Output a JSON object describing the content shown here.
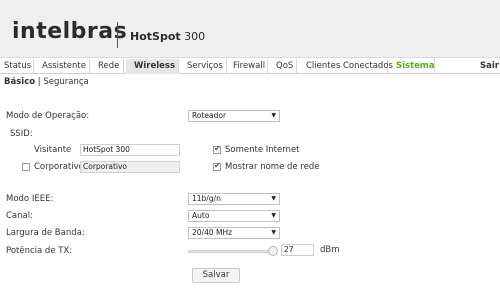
{
  "header": {
    "logo": "intelbras",
    "product_bold": "HotSpot",
    "product_rest": " 300"
  },
  "tabs": [
    {
      "label": "Status"
    },
    {
      "label": "Assistente"
    },
    {
      "label": "Rede"
    },
    {
      "label": "Wireless"
    },
    {
      "label": "Serviços"
    },
    {
      "label": "Firewall"
    },
    {
      "label": "QoS"
    },
    {
      "label": "Clientes Conectados"
    },
    {
      "label": "Sistema"
    },
    {
      "label": "Sair"
    }
  ],
  "active_tab": "Wireless",
  "subtabs": {
    "basic": "Básico",
    "separator": " | ",
    "security": "Segurança"
  },
  "form": {
    "mode_label": "Modo de Operação:",
    "mode_value": "Roteador",
    "ssid_label": "SSID:",
    "visitor_label": "Visitante",
    "visitor_value": "HotSpot 300",
    "internet_only_label": "Somente Internet",
    "internet_only_checked": true,
    "corporate_label": "Corporativo",
    "corporate_checked": false,
    "corporate_value": "Corporativo",
    "show_network_label": "Mostrar nome de rede",
    "show_network_checked": true,
    "ieee_label": "Modo IEEE:",
    "ieee_value": "11b/g/n",
    "channel_label": "Canal:",
    "channel_value": "Auto",
    "bandwidth_label": "Largura de Banda:",
    "bandwidth_value": "20/40 MHz",
    "tx_label": "Potência de TX:",
    "tx_value": "27",
    "tx_unit": "dBm",
    "tx_level_fraction": 0.9,
    "save_label": "Salvar"
  },
  "colors": {
    "accent_green": "#5aaa1e",
    "header_bg": "#efefef"
  }
}
